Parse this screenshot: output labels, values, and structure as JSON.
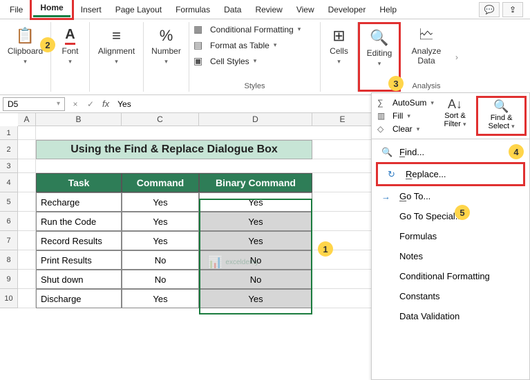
{
  "tabs": {
    "file": "File",
    "home": "Home",
    "insert": "Insert",
    "pageLayout": "Page Layout",
    "formulas": "Formulas",
    "data": "Data",
    "review": "Review",
    "view": "View",
    "developer": "Developer",
    "help": "Help"
  },
  "ribbon": {
    "clipboard": {
      "label": "Clipboard"
    },
    "font": {
      "label": "Font"
    },
    "alignment": {
      "label": "Alignment"
    },
    "number": {
      "label": "Number"
    },
    "styles": {
      "label": "Styles",
      "cf": "Conditional Formatting",
      "ft": "Format as Table",
      "cs": "Cell Styles"
    },
    "cells": {
      "label": "Cells"
    },
    "editing": {
      "label": "Editing"
    },
    "analyze": {
      "label": "Analyze Data",
      "group": "Analysis"
    }
  },
  "namebox": "D5",
  "formula": "Yes",
  "columns": {
    "A": "A",
    "B": "B",
    "C": "C",
    "D": "D",
    "E": "E"
  },
  "title": "Using the Find & Replace Dialogue Box",
  "headers": {
    "task": "Task",
    "cmd": "Command",
    "bin": "Binary Command"
  },
  "rows": [
    {
      "n": "5",
      "task": "Recharge",
      "cmd": "Yes",
      "bin": "Yes"
    },
    {
      "n": "6",
      "task": "Run the Code",
      "cmd": "Yes",
      "bin": "Yes"
    },
    {
      "n": "7",
      "task": "Record Results",
      "cmd": "Yes",
      "bin": "Yes"
    },
    {
      "n": "8",
      "task": "Print Results",
      "cmd": "No",
      "bin": "No"
    },
    {
      "n": "9",
      "task": "Shut down",
      "cmd": "No",
      "bin": "No"
    },
    {
      "n": "10",
      "task": "Discharge",
      "cmd": "Yes",
      "bin": "Yes"
    }
  ],
  "dropdown": {
    "autosum": "AutoSum",
    "fill": "Fill",
    "clear": "Clear",
    "sortfilter": "Sort & Filter",
    "findselect": "Find & Select",
    "menu": {
      "find": "Find...",
      "replace": "Replace...",
      "goto": "Go To...",
      "gotospecial": "Go To Special...",
      "formulas": "Formulas",
      "notes": "Notes",
      "cf": "Conditional Formatting",
      "constants": "Constants",
      "dv": "Data Validation"
    }
  },
  "annotations": {
    "a1": "1",
    "a2": "2",
    "a3": "3",
    "a4": "4",
    "a5": "5"
  },
  "watermark": "exceldemy"
}
